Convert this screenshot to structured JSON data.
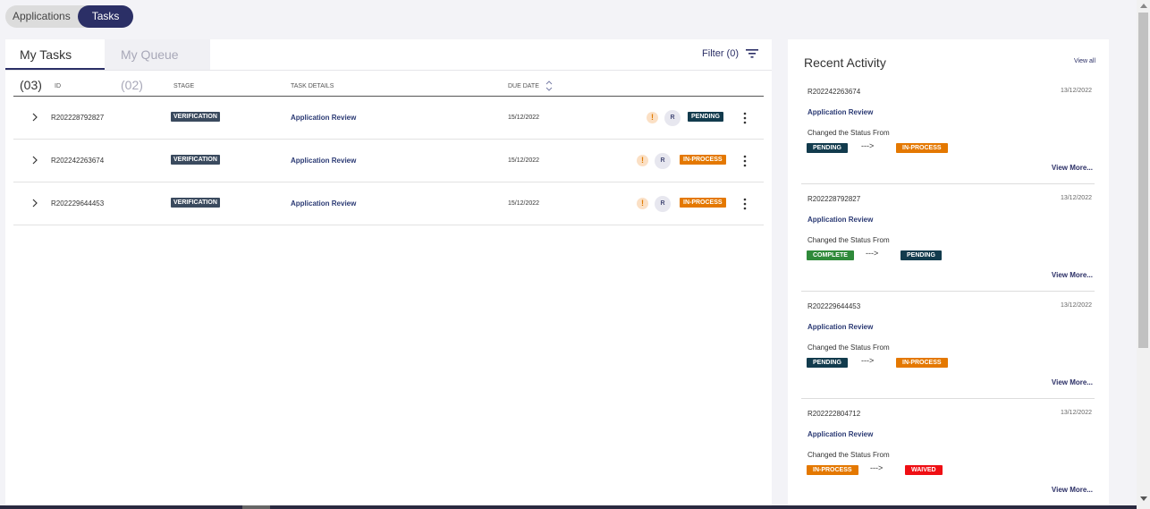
{
  "toggle": {
    "applications": "Applications",
    "tasks": "Tasks"
  },
  "tabs": {
    "my_tasks": "My Tasks (03)",
    "my_queue": "My Queue (02)"
  },
  "filter": {
    "label": "Filter (0)"
  },
  "columns": {
    "id": "ID",
    "stage": "STAGE",
    "details": "TASK DETAILS",
    "due": "DUE DATE"
  },
  "tasks": [
    {
      "id": "R202228792827",
      "stage": "VERIFICATION",
      "details": "Application Review",
      "due": "15/12/2022",
      "avatar": "R",
      "status": "PENDING"
    },
    {
      "id": "R202242263674",
      "stage": "VERIFICATION",
      "details": "Application Review",
      "due": "15/12/2022",
      "avatar": "R",
      "status": "IN-PROCESS"
    },
    {
      "id": "R202229644453",
      "stage": "VERIFICATION",
      "details": "Application Review",
      "due": "15/12/2022",
      "avatar": "R",
      "status": "IN-PROCESS"
    }
  ],
  "activity": {
    "title": "Recent Activity",
    "view_all": "View all",
    "items": [
      {
        "id": "R202242263674",
        "date": "13/12/2022",
        "title": "Application Review",
        "text": "Changed the Status From",
        "from": "PENDING",
        "arrow": "--->",
        "to": "IN-PROCESS",
        "more": "View More..."
      },
      {
        "id": "R202228792827",
        "date": "13/12/2022",
        "title": "Application Review",
        "text": "Changed the Status From",
        "from": "COMPLETE",
        "arrow": "--->",
        "to": "PENDING",
        "more": "View More..."
      },
      {
        "id": "R202229644453",
        "date": "13/12/2022",
        "title": "Application Review",
        "text": "Changed the Status From",
        "from": "PENDING",
        "arrow": "--->",
        "to": "IN-PROCESS",
        "more": "View More..."
      },
      {
        "id": "R202222804712",
        "date": "13/12/2022",
        "title": "Application Review",
        "text": "Changed the Status From",
        "from": "IN-PROCESS",
        "arrow": "--->",
        "to": "WAIVED",
        "more": "View More..."
      }
    ]
  },
  "colors": {
    "pending": "#123b4d",
    "in_process": "#e47800",
    "complete": "#2f8a3a",
    "waived": "#ef0f14",
    "accent": "#2b2f66"
  }
}
